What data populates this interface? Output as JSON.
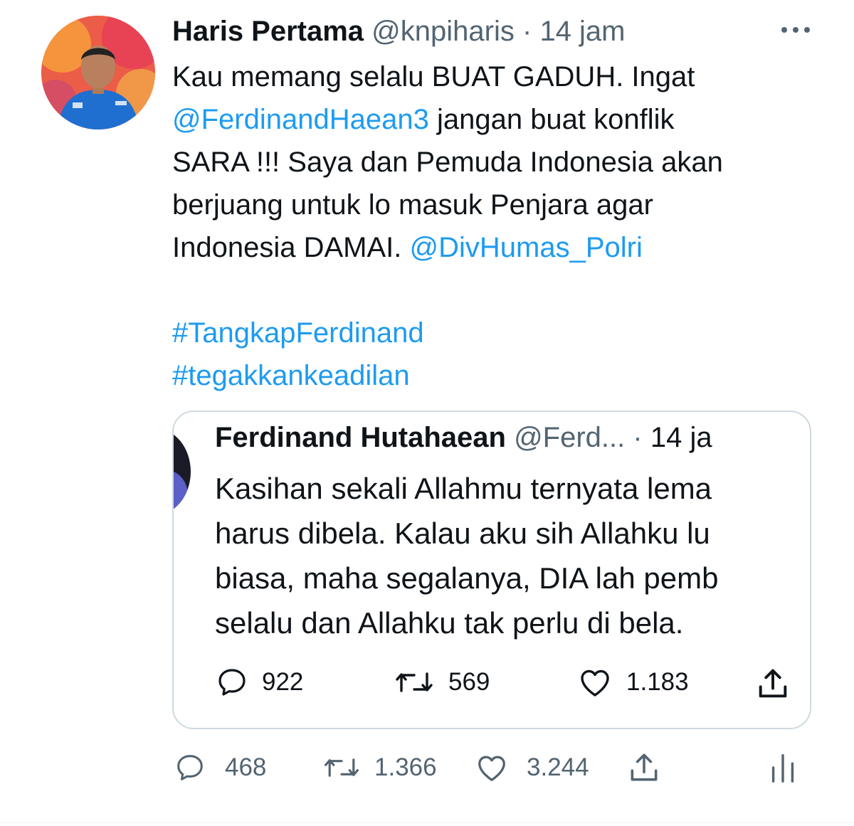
{
  "tweet": {
    "author_name": "Haris Pertama",
    "handle": "@knpiharis",
    "separator": "·",
    "time": "14 jam",
    "text_line1": "Kau memang selalu BUAT GADUH. Ingat",
    "mention1": "@FerdinandHaean3",
    "text_line2_rest": " jangan buat konflik",
    "text_line3": "SARA !!! Saya dan Pemuda Indonesia akan",
    "text_line4": "berjuang untuk lo masuk Penjara agar",
    "text_line5": "Indonesia DAMAI. ",
    "mention2": "@DivHumas_Polri",
    "hashtag1": "#TangkapFerdinand",
    "hashtag2": "#tegakkankeadilan",
    "actions": {
      "replies": "468",
      "retweets": "1.366",
      "likes": "3.244"
    }
  },
  "quoted_tweet": {
    "author_name": "Ferdinand Hutahaean",
    "handle": "@Ferd...",
    "separator": "·",
    "time": "14 ja",
    "lines": [
      "Kasihan sekali Allahmu ternyata lema",
      "harus dibela. Kalau aku sih Allahku lu",
      "biasa, maha segalanya, DIA lah pemb",
      "selalu dan Allahku tak perlu di bela."
    ],
    "actions": {
      "replies": "922",
      "retweets": "569",
      "likes": "1.183"
    }
  },
  "colors": {
    "link": "#1d9bf0",
    "secondary_text": "#536471",
    "border": "#cfd9de"
  },
  "icons": [
    "more-icon",
    "reply-icon",
    "retweet-icon",
    "like-icon",
    "share-icon",
    "analytics-icon"
  ]
}
